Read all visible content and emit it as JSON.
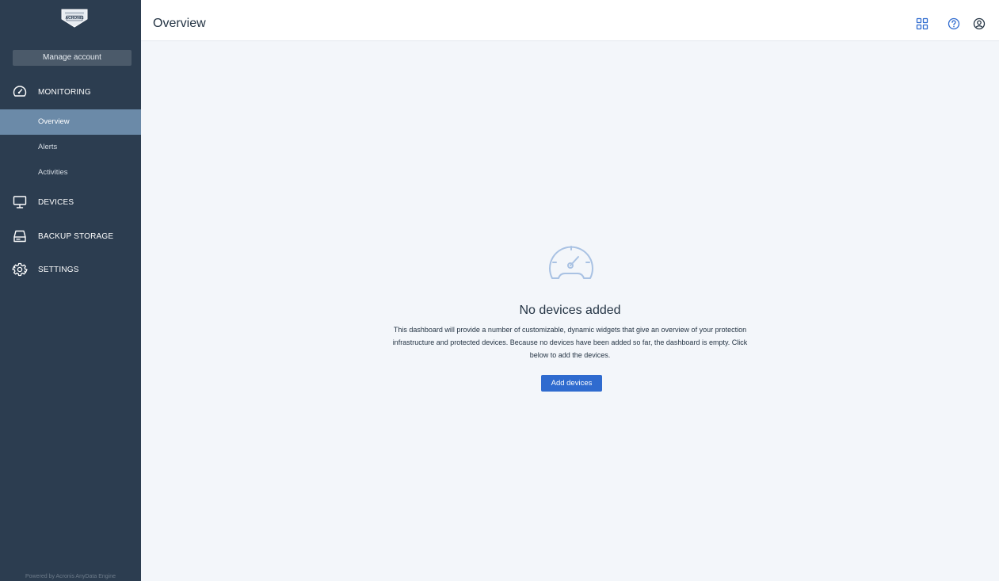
{
  "app": {
    "logo_text": "ACRONIS"
  },
  "sidebar": {
    "manage_account": "Manage account",
    "sections": [
      {
        "label": "MONITORING",
        "icon": "speedometer-icon"
      },
      {
        "label": "DEVICES",
        "icon": "monitor-icon"
      },
      {
        "label": "BACKUP STORAGE",
        "icon": "storage-icon"
      },
      {
        "label": "SETTINGS",
        "icon": "gear-icon"
      }
    ],
    "monitoring_items": [
      {
        "label": "Overview",
        "active": true
      },
      {
        "label": "Alerts",
        "active": false
      },
      {
        "label": "Activities",
        "active": false
      }
    ],
    "footer": "Powered by Acronis AnyData Engine"
  },
  "header": {
    "title": "Overview",
    "icons": [
      "grid-icon",
      "help-icon",
      "account-icon"
    ]
  },
  "empty_state": {
    "title": "No devices added",
    "description": "This dashboard will provide a number of customizable, dynamic widgets that give an overview of your protection infrastructure and protected devices. Because no devices have been added so far, the dashboard is empty. Click below to add the devices.",
    "button_label": "Add devices"
  },
  "colors": {
    "sidebar_bg": "#2c3d50",
    "active_item_bg": "#6b8aa8",
    "primary": "#2f6bcf",
    "content_bg": "#f3f6fa"
  }
}
